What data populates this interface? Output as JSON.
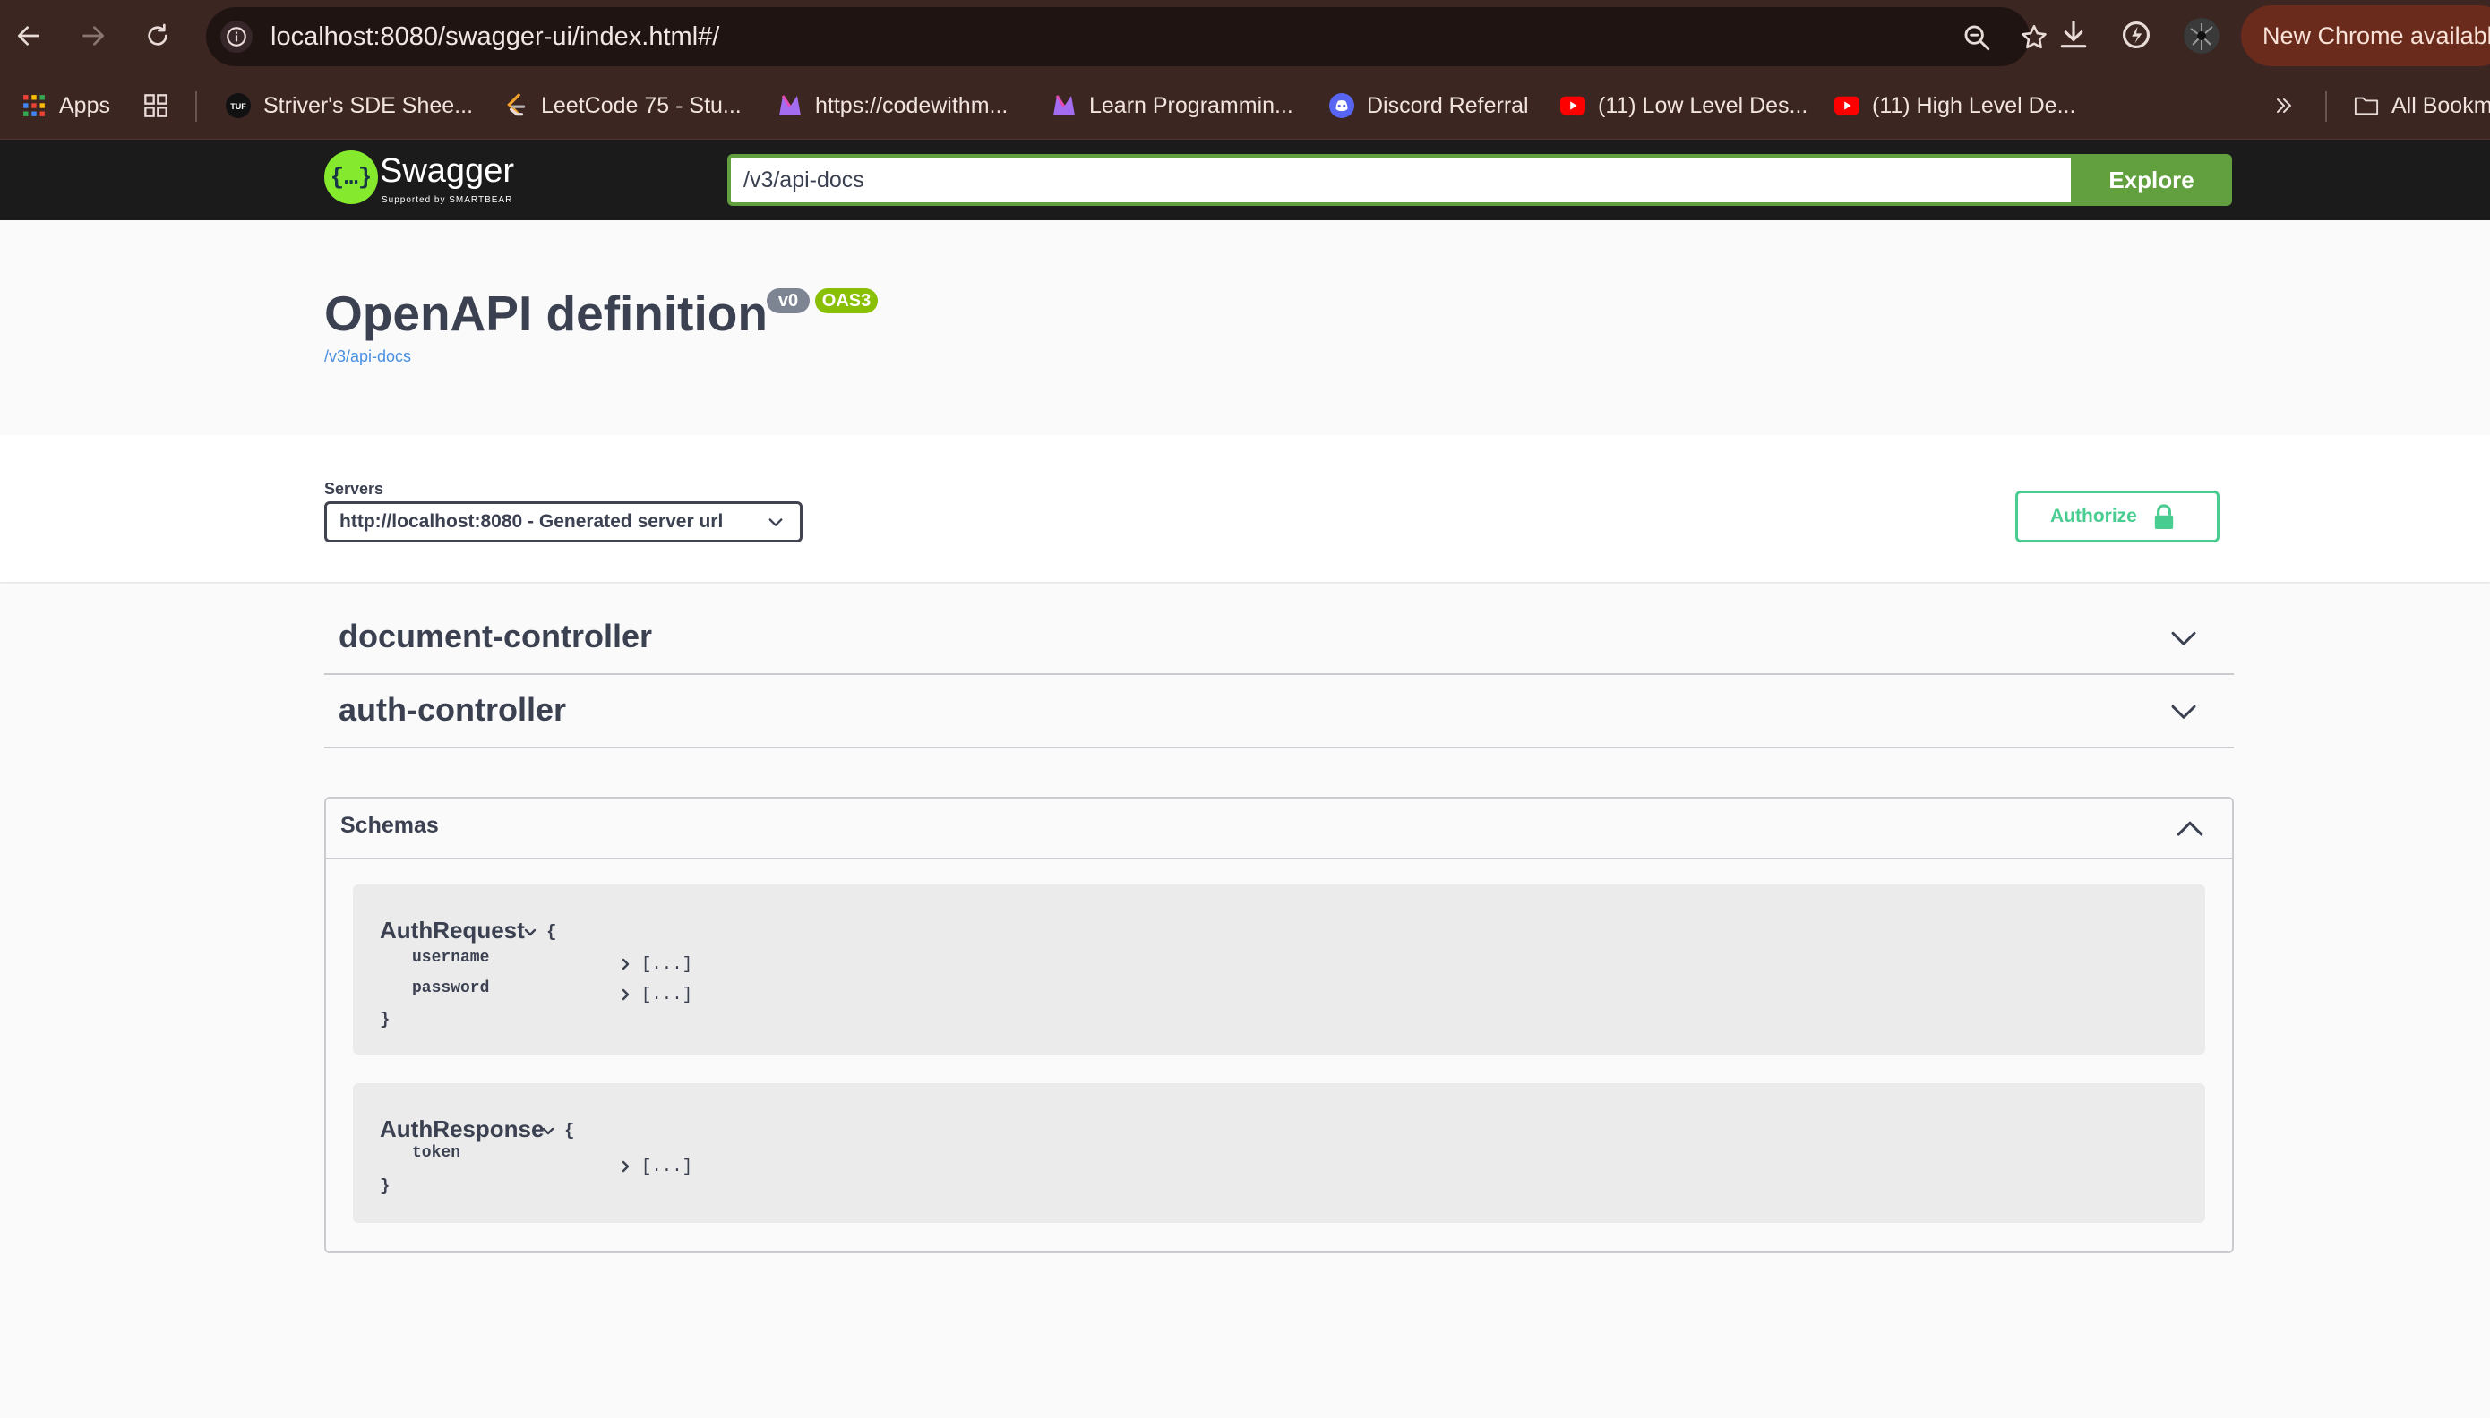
{
  "browser": {
    "url": "localhost:8080/swagger-ui/index.html#/",
    "update_label": "New Chrome available",
    "bookmarks": [
      {
        "label": "Apps",
        "icon": "apps-grid-icon"
      },
      {
        "label": "Striver's SDE Shee...",
        "icon": "tuf-favicon"
      },
      {
        "label": "LeetCode 75 - Stu...",
        "icon": "leetcode-favicon"
      },
      {
        "label": "https://codewithm...",
        "icon": "codewithmosh-favicon"
      },
      {
        "label": "Learn Programmin...",
        "icon": "codewithmosh-favicon"
      },
      {
        "label": "Discord Referral",
        "icon": "discord-favicon"
      },
      {
        "label": "(11) Low Level Des...",
        "icon": "youtube-favicon"
      },
      {
        "label": "(11) High Level De...",
        "icon": "youtube-favicon"
      }
    ],
    "all_bookmarks_label": "All Bookmarks"
  },
  "swagger": {
    "brand": "Swagger",
    "brand_sub": "Supported by SMARTBEAR",
    "spec_url": "/v3/api-docs",
    "explore_label": "Explore",
    "colors": {
      "accent": "#62a03f",
      "authorize": "#49cc90",
      "logo": "#85ea2d"
    }
  },
  "info": {
    "title": "OpenAPI definition",
    "version_badge": "v0",
    "oas_badge": "OAS3",
    "spec_link": "/v3/api-docs"
  },
  "servers": {
    "label": "Servers",
    "selected": "http://localhost:8080 - Generated server url",
    "authorize_label": "Authorize"
  },
  "tags": [
    {
      "name": "document-controller",
      "expanded": false
    },
    {
      "name": "auth-controller",
      "expanded": false
    }
  ],
  "schemas": {
    "title": "Schemas",
    "expanded": true,
    "models": [
      {
        "name": "AuthRequest",
        "open_brace": "{",
        "close_brace": "}",
        "properties": [
          {
            "name": "username",
            "value": "[...]"
          },
          {
            "name": "password",
            "value": "[...]"
          }
        ]
      },
      {
        "name": "AuthResponse",
        "open_brace": "{",
        "close_brace": "}",
        "properties": [
          {
            "name": "token",
            "value": "[...]"
          }
        ]
      }
    ]
  }
}
